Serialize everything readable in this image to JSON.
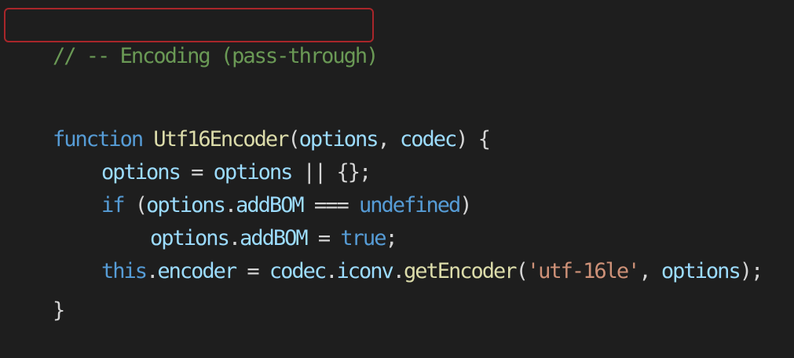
{
  "theme": {
    "background": "#1e1e1e",
    "comment": "#6a9955",
    "keyword": "#569cd6",
    "function": "#dcdcaa",
    "variable": "#9cdcfe",
    "punctuation": "#d4d4d4",
    "string": "#ce9178",
    "highlight_box": "#a8262a"
  },
  "code": {
    "line1": {
      "comment": "// -- Encoding (pass-through)"
    },
    "line2": {
      "keyword": "function",
      "name": " Utf16Encoder",
      "open": "(",
      "p1": "options",
      "comma": ", ",
      "p2": "codec",
      "close": ") {"
    },
    "line3": {
      "a": "options",
      "eq": " = ",
      "b": "options",
      "or": " || ",
      "rest": "{};"
    },
    "line4": {
      "kw": "if",
      "open": " (",
      "obj": "options",
      "dot": ".",
      "prop": "addBOM",
      "op": " === ",
      "undef": "undefined",
      "close": ")"
    },
    "line5": {
      "obj": "options",
      "dot": ".",
      "prop": "addBOM",
      "eq": " = ",
      "val": "true",
      "semi": ";"
    },
    "line6": {
      "this": "this",
      "dot1": ".",
      "encoder": "encoder",
      "eq": " = ",
      "codec": "codec",
      "dot2": ".",
      "iconv": "iconv",
      "dot3": ".",
      "fn": "getEncoder",
      "open": "(",
      "str": "'utf-16le'",
      "comma": ", ",
      "arg": "options",
      "close": ");"
    },
    "line7": {
      "brace": "}"
    }
  }
}
